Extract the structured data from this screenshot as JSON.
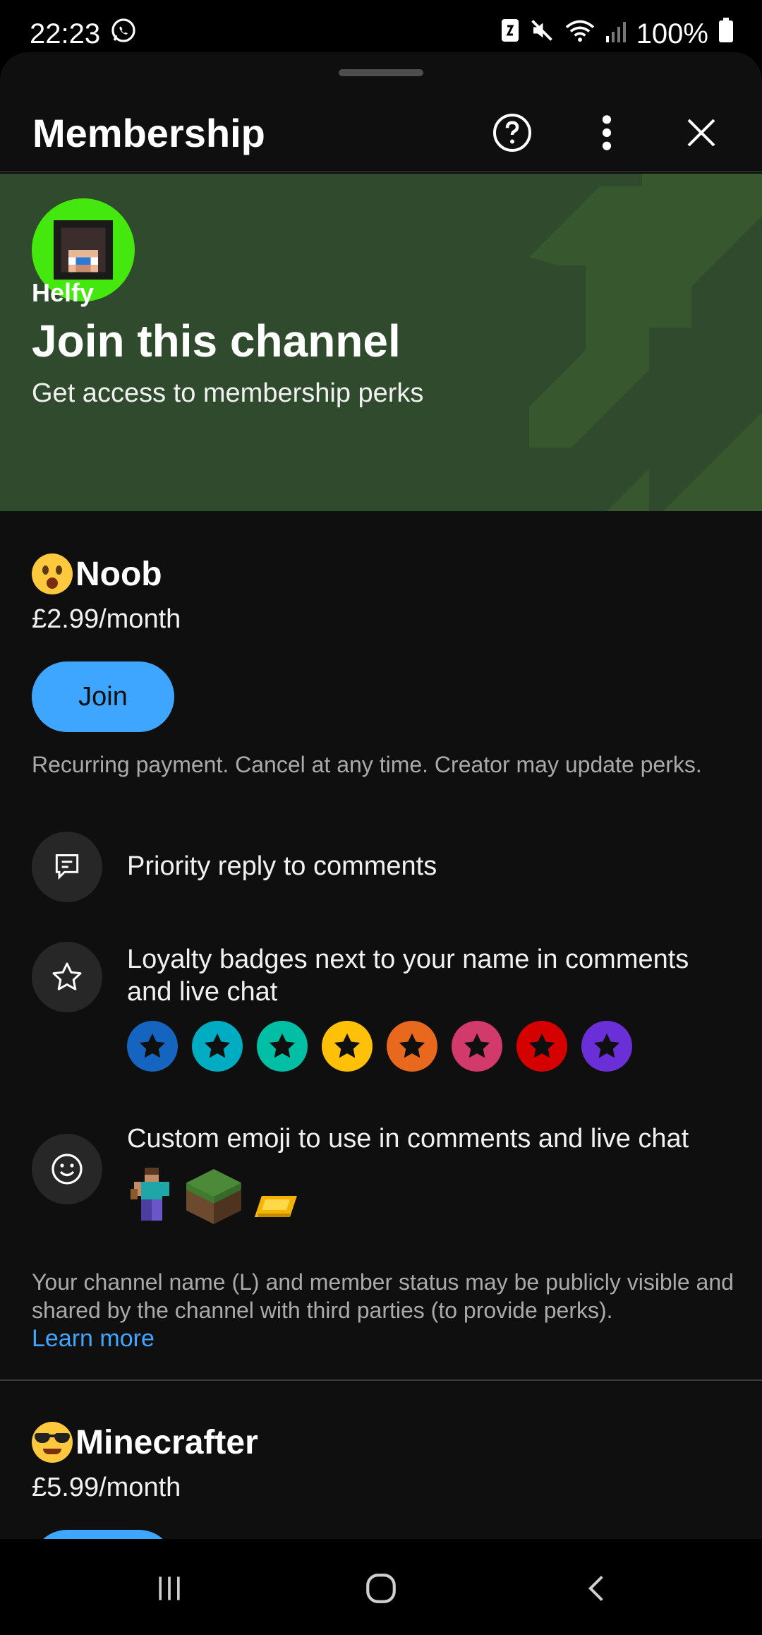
{
  "status": {
    "time": "22:23",
    "battery": "100%"
  },
  "header": {
    "title": "Membership"
  },
  "banner": {
    "channel": "Helfy",
    "title": "Join this channel",
    "subtitle": "Get access to membership perks"
  },
  "tiers": [
    {
      "name": "Noob",
      "price": "£2.99/month",
      "join_label": "Join",
      "recurring_note": "Recurring payment. Cancel at any time. Creator may update perks.",
      "perks": [
        {
          "icon": "comment-icon",
          "text": "Priority reply to comments"
        },
        {
          "icon": "star-icon",
          "text": "Loyalty badges next to your name in comments and live chat"
        },
        {
          "icon": "smiley-icon",
          "text": "Custom emoji to use in comments and live chat"
        }
      ],
      "badge_colors": [
        "#1565c0",
        "#00acc1",
        "#00bfa5",
        "#ffc107",
        "#e8681e",
        "#d13a6b",
        "#d50000",
        "#6a2fd6"
      ],
      "disclaimer": "Your channel name (L) and member status may be publicly visible and shared by the channel with third parties (to provide perks).",
      "learn_more": "Learn more"
    },
    {
      "name": "Minecrafter",
      "price": "£5.99/month"
    }
  ],
  "colors": {
    "accent": "#3ea6ff",
    "banner": "#2f4a2c",
    "avatar_bg": "#44e80e"
  }
}
